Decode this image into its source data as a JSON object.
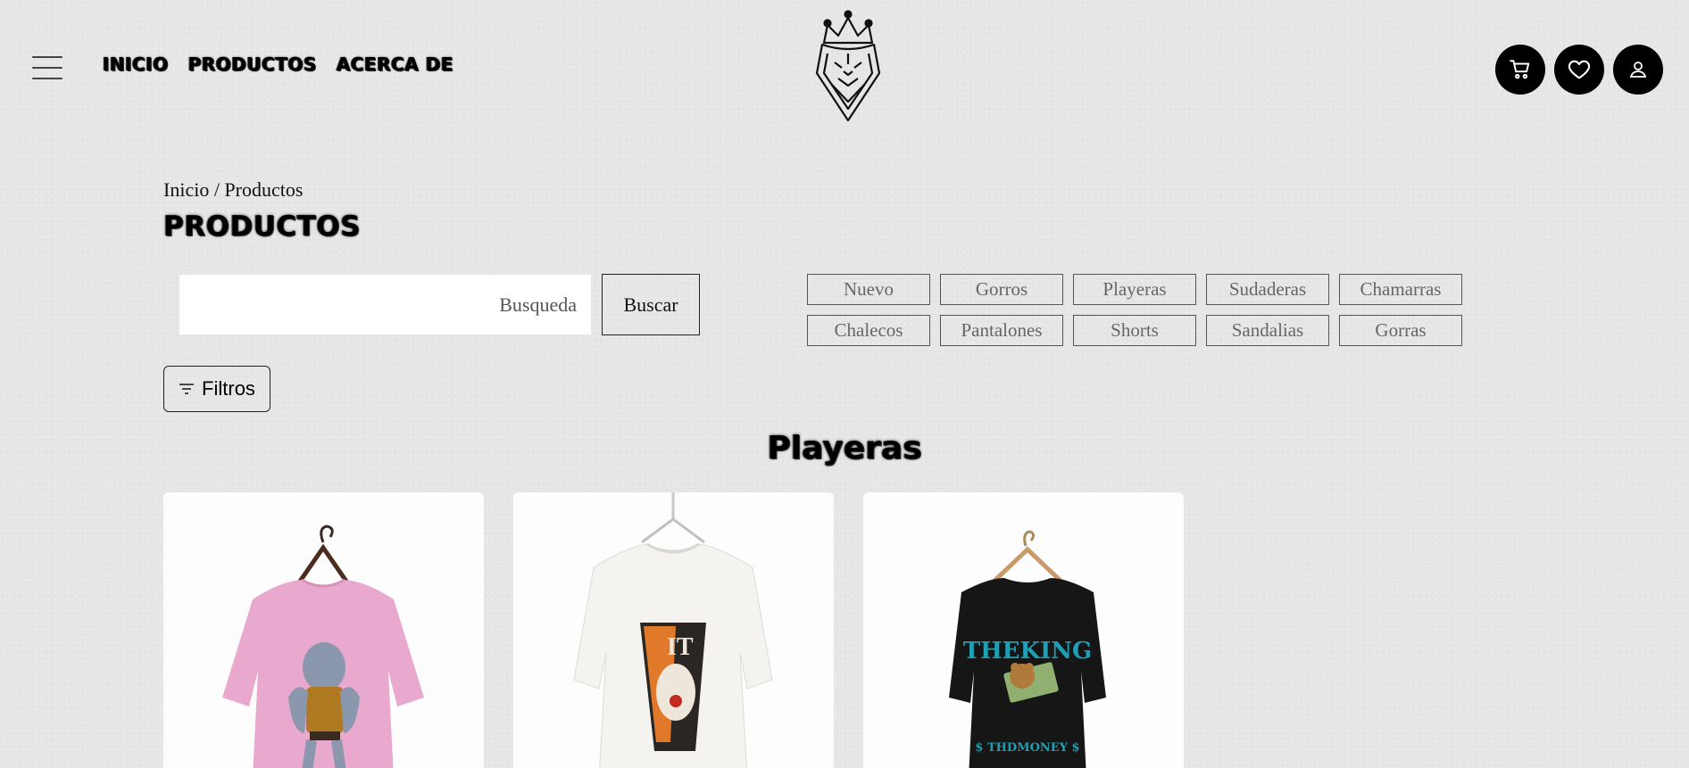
{
  "nav": {
    "items": [
      {
        "label": "INICIO"
      },
      {
        "label": "PRODUCTOS"
      },
      {
        "label": "ACERCA DE"
      }
    ]
  },
  "icons": {
    "menu": "hamburger-menu-icon",
    "logo": "tiger-crown-logo",
    "cart": "cart-icon",
    "wishlist": "heart-icon",
    "account": "user-icon",
    "filter": "filter-icon"
  },
  "breadcrumb": "Inicio / Productos",
  "page_title": "PRODUCTOS",
  "search": {
    "placeholder": "Busqueda",
    "value": "",
    "button_label": "Buscar"
  },
  "categories": [
    "Nuevo",
    "Gorros",
    "Playeras",
    "Sudaderas",
    "Chamarras",
    "Chalecos",
    "Pantalones",
    "Shorts",
    "Sandalias",
    "Gorras"
  ],
  "filters_label": "Filtros",
  "section_title": "Playeras",
  "products": [
    {
      "color": "#e9a9cf",
      "print_text": ""
    },
    {
      "color": "#f4f3ef",
      "print_text": "IT"
    },
    {
      "color": "#161616",
      "print_text": "THEKING",
      "print_sub": "$ THDMONEY $"
    }
  ],
  "colors": {
    "background": "#e6e6e6",
    "icon_button": "#000000",
    "accent_print": "#1f9fb3"
  }
}
